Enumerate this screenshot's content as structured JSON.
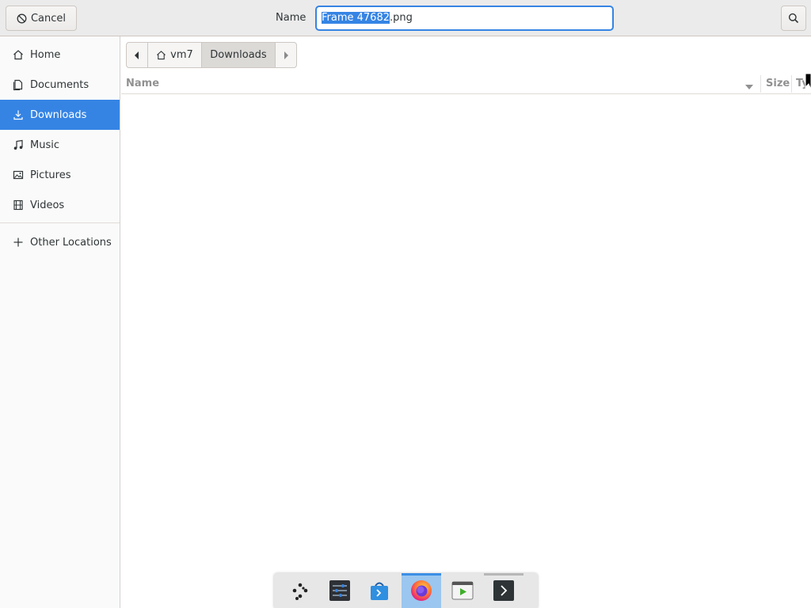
{
  "header": {
    "cancel_label": "Cancel",
    "name_label": "Name",
    "filename_selected": "Frame 47682",
    "filename_rest": ".png"
  },
  "sidebar": {
    "items": [
      {
        "label": "Home",
        "icon": "home-icon"
      },
      {
        "label": "Documents",
        "icon": "documents-icon"
      },
      {
        "label": "Downloads",
        "icon": "downloads-icon",
        "active": true
      },
      {
        "label": "Music",
        "icon": "music-icon"
      },
      {
        "label": "Pictures",
        "icon": "pictures-icon"
      },
      {
        "label": "Videos",
        "icon": "videos-icon"
      },
      {
        "label": "Other Locations",
        "icon": "plus-icon"
      }
    ]
  },
  "pathbar": {
    "segments": [
      "vm7",
      "Downloads"
    ]
  },
  "columns": {
    "name": "Name",
    "size": "Size",
    "type": "Ty"
  },
  "dock": {
    "apps": [
      "app-grid-icon",
      "settings-icon",
      "software-store-icon",
      "firefox-icon",
      "media-player-icon",
      "terminal-icon"
    ]
  },
  "colors": {
    "accent": "#3584e4",
    "header_bg": "#ebebeb",
    "sidebar_bg": "#fafafa"
  }
}
